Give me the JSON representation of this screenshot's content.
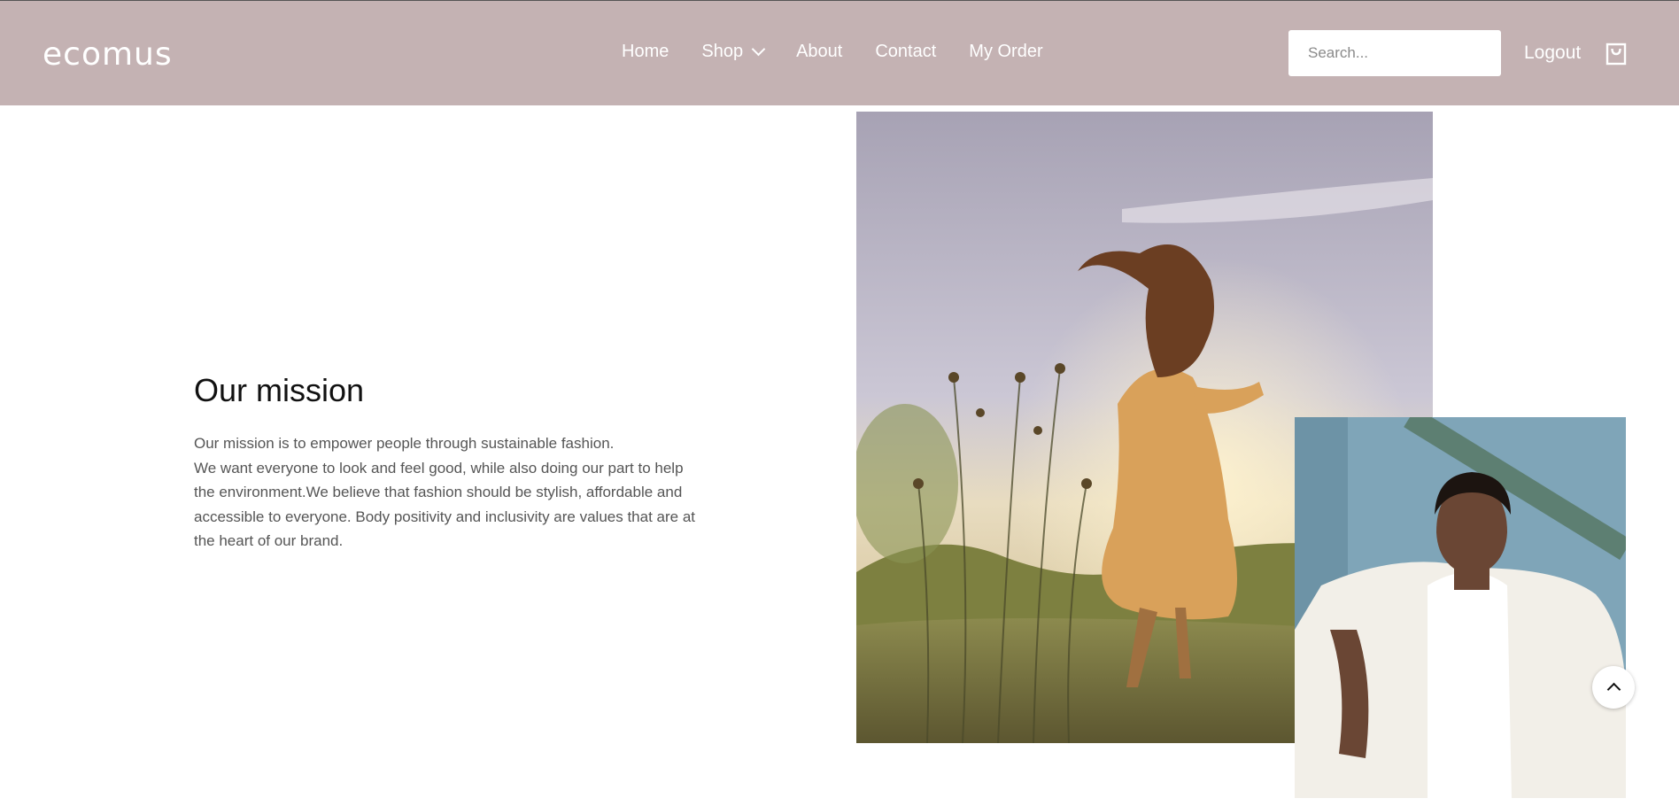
{
  "header": {
    "logo_text": "ecomus",
    "nav": [
      {
        "label": "Home"
      },
      {
        "label": "Shop",
        "has_dropdown": true
      },
      {
        "label": "About"
      },
      {
        "label": "Contact"
      },
      {
        "label": "My Order"
      }
    ],
    "search_placeholder": "Search...",
    "logout_label": "Logout",
    "cart_icon": "shopping-bag-icon"
  },
  "mission": {
    "title": "Our mission",
    "text": "Our mission is to empower people through sustainable fashion.\nWe want everyone to look and feel good, while also doing our part to help the environment.We believe that fashion should be stylish, affordable and accessible to everyone. Body positivity and inclusivity are values that are at the heart of our brand."
  },
  "images": {
    "large": "woman-in-field-photo",
    "small": "man-portrait-photo"
  },
  "scroll_top_icon": "chevron-up-icon",
  "colors": {
    "header_bg": "#c4b2b3",
    "header_text": "#ffffff",
    "title_text": "#111111",
    "body_text": "#555555"
  }
}
